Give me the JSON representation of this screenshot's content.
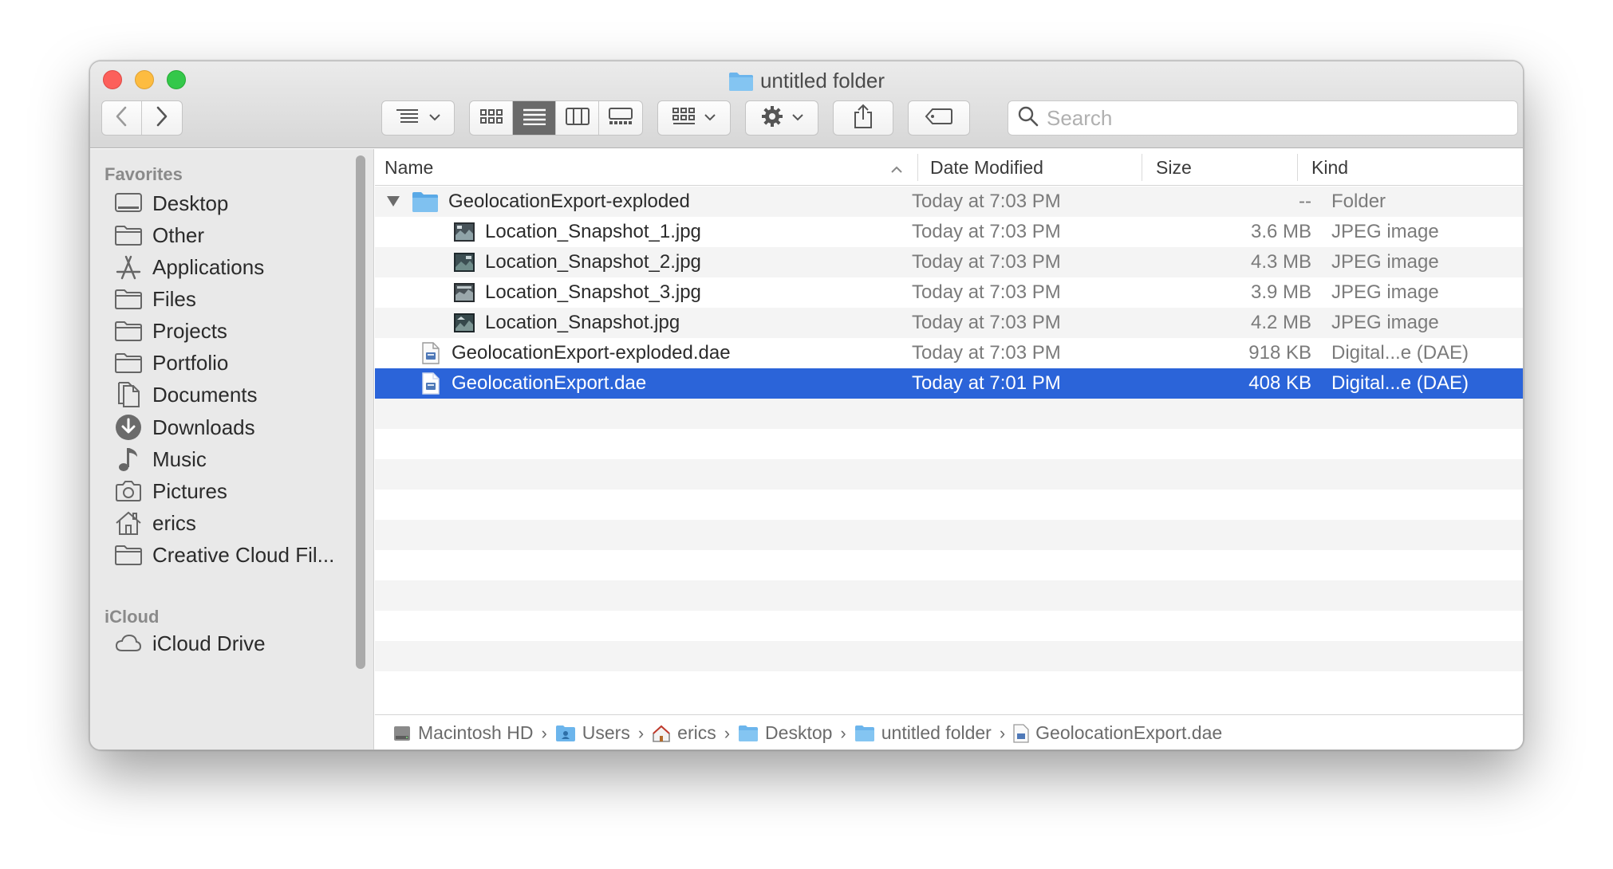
{
  "window": {
    "title": "untitled folder"
  },
  "toolbar": {
    "back_icon": "chevron-left-icon",
    "forward_icon": "chevron-right-icon",
    "arrange_icon": "list-arrange-icon",
    "views": [
      "icon-view",
      "list-view",
      "column-view",
      "gallery-view"
    ],
    "active_view": "list-view",
    "group_icon": "group-icon",
    "action_icon": "gear-icon",
    "share_icon": "share-icon",
    "tags_icon": "tag-icon",
    "search_placeholder": "Search"
  },
  "sidebar": {
    "favorites_heading": "Favorites",
    "items": [
      {
        "label": "Desktop",
        "icon": "desktop-icon"
      },
      {
        "label": "Other",
        "icon": "folder-icon"
      },
      {
        "label": "Applications",
        "icon": "applications-icon"
      },
      {
        "label": "Files",
        "icon": "folder-icon"
      },
      {
        "label": "Projects",
        "icon": "folder-icon"
      },
      {
        "label": "Portfolio",
        "icon": "folder-icon"
      },
      {
        "label": "Documents",
        "icon": "documents-icon"
      },
      {
        "label": "Downloads",
        "icon": "downloads-icon"
      },
      {
        "label": "Music",
        "icon": "music-icon"
      },
      {
        "label": "Pictures",
        "icon": "camera-icon"
      },
      {
        "label": "erics",
        "icon": "home-icon"
      },
      {
        "label": "Creative Cloud Fil...",
        "icon": "folder-icon"
      }
    ],
    "icloud_heading": "iCloud",
    "icloud_items": [
      {
        "label": "iCloud Drive",
        "icon": "cloud-icon"
      }
    ]
  },
  "columns": {
    "name": "Name",
    "date": "Date Modified",
    "size": "Size",
    "kind": "Kind"
  },
  "files": [
    {
      "name": "GeolocationExport-exploded",
      "date": "Today at 7:03 PM",
      "size": "--",
      "kind": "Folder"
    },
    {
      "name": "Location_Snapshot_1.jpg",
      "date": "Today at 7:03 PM",
      "size": "3.6 MB",
      "kind": "JPEG image"
    },
    {
      "name": "Location_Snapshot_2.jpg",
      "date": "Today at 7:03 PM",
      "size": "4.3 MB",
      "kind": "JPEG image"
    },
    {
      "name": "Location_Snapshot_3.jpg",
      "date": "Today at 7:03 PM",
      "size": "3.9 MB",
      "kind": "JPEG image"
    },
    {
      "name": "Location_Snapshot.jpg",
      "date": "Today at 7:03 PM",
      "size": "4.2 MB",
      "kind": "JPEG image"
    },
    {
      "name": "GeolocationExport-exploded.dae",
      "date": "Today at 7:03 PM",
      "size": "918 KB",
      "kind": "Digital...e (DAE)"
    },
    {
      "name": "GeolocationExport.dae",
      "date": "Today at 7:01 PM",
      "size": "408 KB",
      "kind": "Digital...e (DAE)"
    }
  ],
  "path": [
    {
      "label": "Macintosh HD",
      "icon": "hard-drive-icon"
    },
    {
      "label": "Users",
      "icon": "users-folder-icon"
    },
    {
      "label": "erics",
      "icon": "home-icon"
    },
    {
      "label": "Desktop",
      "icon": "folder-icon"
    },
    {
      "label": "untitled folder",
      "icon": "folder-icon"
    },
    {
      "label": "GeolocationExport.dae",
      "icon": "document-icon"
    }
  ],
  "colors": {
    "selection": "#2b64d9",
    "folder": "#6cb5ec",
    "sidebar_bg": "#e9e9e9"
  }
}
